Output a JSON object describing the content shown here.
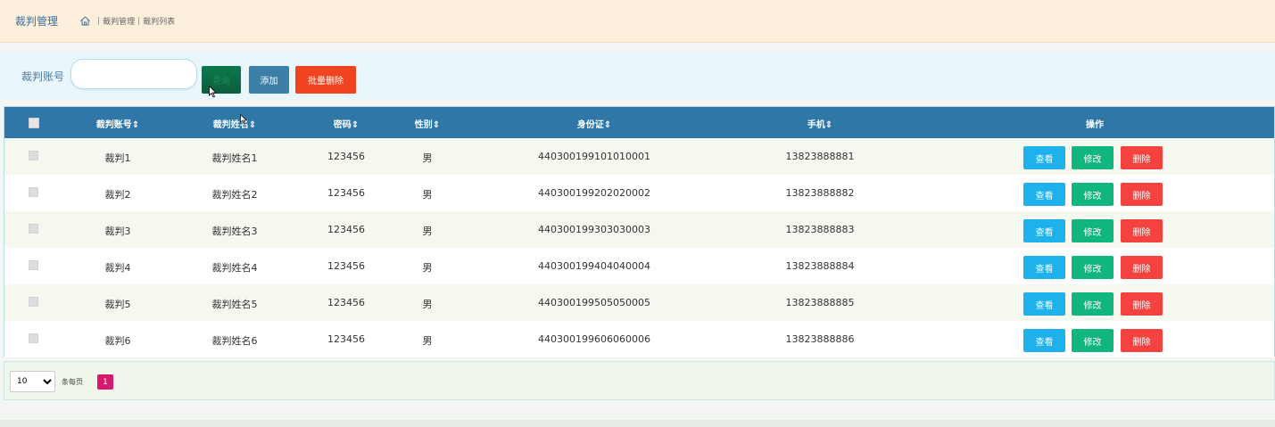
{
  "header": {
    "title": "裁判管理",
    "breadcrumb": [
      "裁判管理",
      "裁判列表"
    ],
    "separator": "|"
  },
  "search": {
    "label": "裁判账号",
    "input_value": "",
    "search_label": "查询",
    "add_label": "添加",
    "batch_delete_label": "批量删除"
  },
  "table": {
    "columns": [
      "裁判账号",
      "裁判姓名",
      "密码",
      "性别",
      "身份证",
      "手机",
      "操作"
    ],
    "sort_icon": "⇕",
    "rows": [
      {
        "account": "裁判1",
        "name": "裁判姓名1",
        "password": "123456",
        "gender": "男",
        "id_card": "440300199101010001",
        "phone": "13823888881"
      },
      {
        "account": "裁判2",
        "name": "裁判姓名2",
        "password": "123456",
        "gender": "男",
        "id_card": "440300199202020002",
        "phone": "13823888882"
      },
      {
        "account": "裁判3",
        "name": "裁判姓名3",
        "password": "123456",
        "gender": "男",
        "id_card": "440300199303030003",
        "phone": "13823888883"
      },
      {
        "account": "裁判4",
        "name": "裁判姓名4",
        "password": "123456",
        "gender": "男",
        "id_card": "440300199404040004",
        "phone": "13823888884"
      },
      {
        "account": "裁判5",
        "name": "裁判姓名5",
        "password": "123456",
        "gender": "男",
        "id_card": "440300199505050005",
        "phone": "13823888885"
      },
      {
        "account": "裁判6",
        "name": "裁判姓名6",
        "password": "123456",
        "gender": "男",
        "id_card": "440300199606060006",
        "phone": "13823888886"
      }
    ],
    "actions": {
      "view": "查看",
      "edit": "修改",
      "delete": "删除"
    }
  },
  "pagination": {
    "page_size": "10",
    "page_size_options": [
      "10"
    ],
    "per_page_label": "条每页",
    "current_page": "1"
  },
  "colors": {
    "header_bg": "#2e77a6",
    "view": "#1fb1ec",
    "edit": "#11b67e",
    "delete": "#f4433f",
    "page_active": "#d6186e"
  },
  "icons": {
    "home": "home-icon",
    "sort": "sort-icon",
    "dropdown": "chevron-down-icon"
  }
}
